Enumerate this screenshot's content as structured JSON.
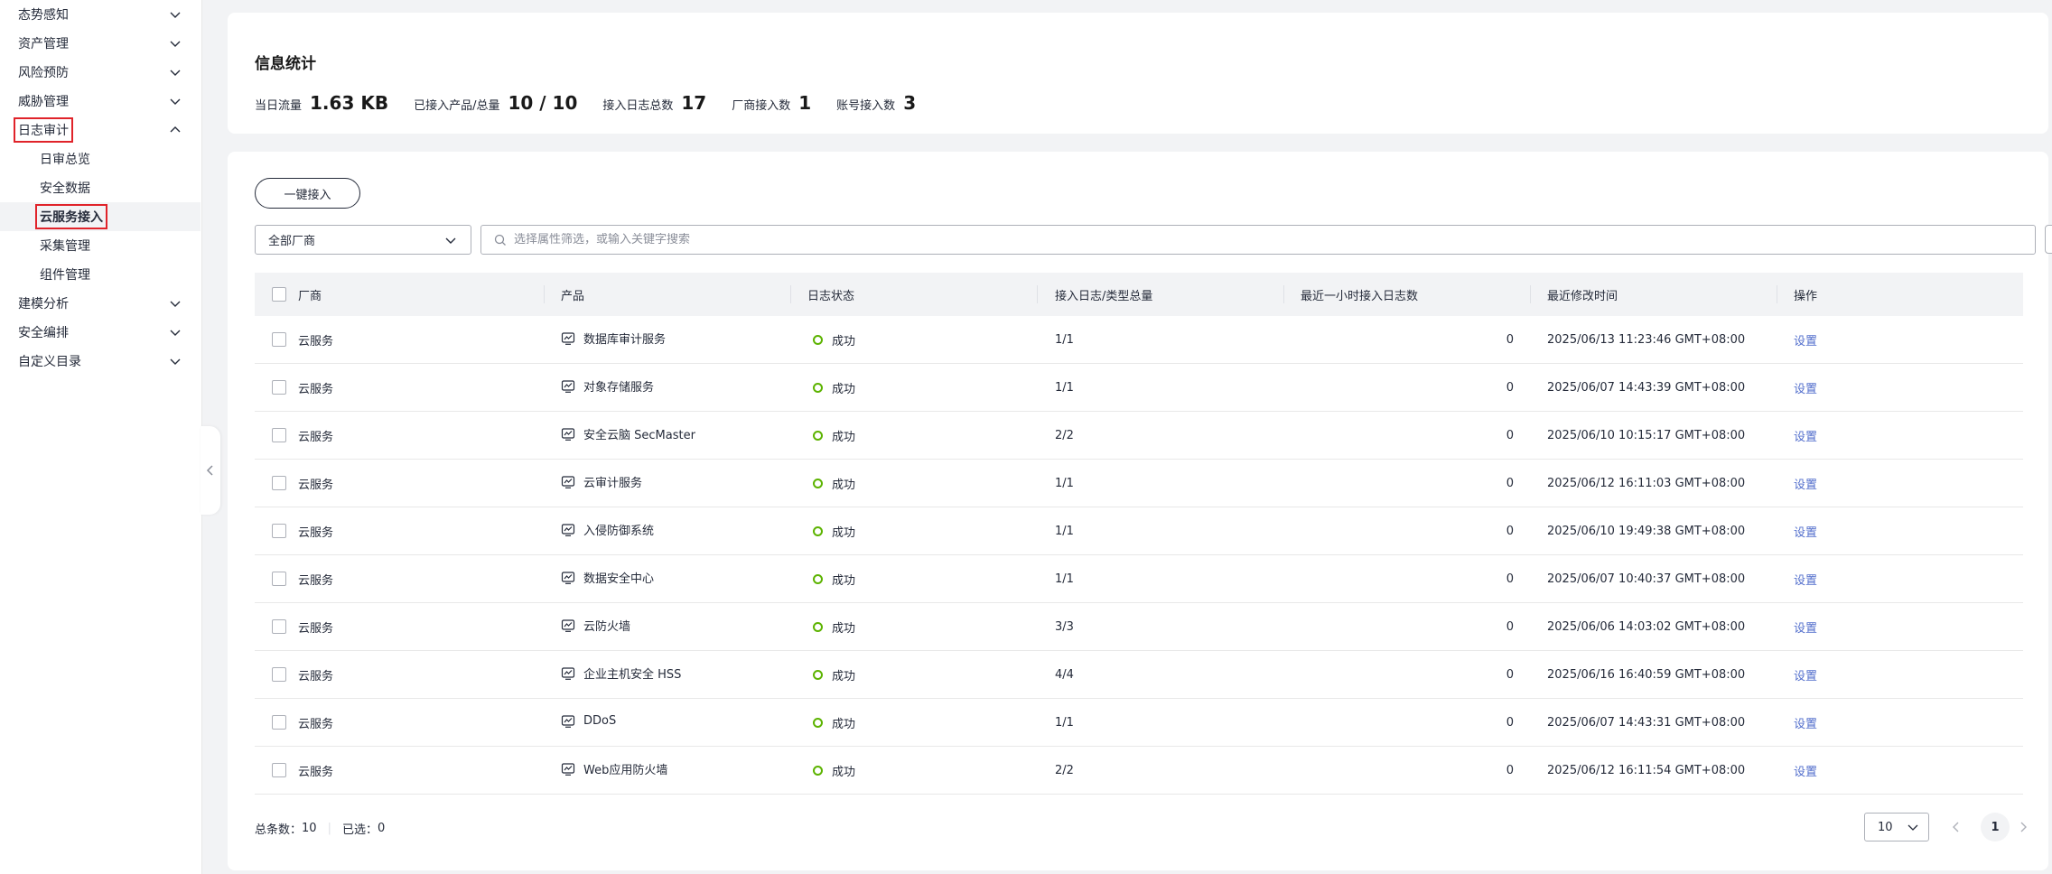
{
  "sidebar": {
    "groups_top": [
      {
        "label": "态势感知",
        "expanded": false
      },
      {
        "label": "资产管理",
        "expanded": false
      },
      {
        "label": "风险预防",
        "expanded": false
      },
      {
        "label": "威胁管理",
        "expanded": false
      },
      {
        "label": "日志审计",
        "expanded": true
      }
    ],
    "sub_items": [
      {
        "label": "日审总览"
      },
      {
        "label": "安全数据"
      },
      {
        "label": "云服务接入",
        "active": true
      },
      {
        "label": "采集管理"
      },
      {
        "label": "组件管理"
      }
    ],
    "groups_bottom": [
      {
        "label": "建模分析",
        "expanded": false
      },
      {
        "label": "安全编排",
        "expanded": false
      },
      {
        "label": "自定义目录",
        "expanded": false
      }
    ]
  },
  "stats": {
    "title": "信息统计",
    "items": [
      {
        "label": "当日流量",
        "value": "1.63 KB"
      },
      {
        "label": "已接入产品/总量",
        "value": "10 / 10"
      },
      {
        "label": "接入日志总数",
        "value": "17"
      },
      {
        "label": "厂商接入数",
        "value": "1"
      },
      {
        "label": "账号接入数",
        "value": "3"
      }
    ]
  },
  "toolbar": {
    "onekey_label": "一键接入",
    "vendor_select": "全部厂商",
    "search_placeholder": "选择属性筛选，或输入关键字搜索"
  },
  "table": {
    "headers": {
      "vendor": "厂商",
      "product": "产品",
      "status": "日志状态",
      "types": "接入日志/类型总量",
      "recent": "最近一小时接入日志数",
      "modified": "最近修改时间",
      "action": "操作"
    },
    "rows": [
      {
        "vendor": "云服务",
        "product": "数据库审计服务",
        "status": "成功",
        "types": "1/1",
        "recent": "0",
        "modified": "2025/06/13 11:23:46 GMT+08:00",
        "action": "设置"
      },
      {
        "vendor": "云服务",
        "product": "对象存储服务",
        "status": "成功",
        "types": "1/1",
        "recent": "0",
        "modified": "2025/06/07 14:43:39 GMT+08:00",
        "action": "设置"
      },
      {
        "vendor": "云服务",
        "product": "安全云脑 SecMaster",
        "status": "成功",
        "types": "2/2",
        "recent": "0",
        "modified": "2025/06/10 10:15:17 GMT+08:00",
        "action": "设置"
      },
      {
        "vendor": "云服务",
        "product": "云审计服务",
        "status": "成功",
        "types": "1/1",
        "recent": "0",
        "modified": "2025/06/12 16:11:03 GMT+08:00",
        "action": "设置"
      },
      {
        "vendor": "云服务",
        "product": "入侵防御系统",
        "status": "成功",
        "types": "1/1",
        "recent": "0",
        "modified": "2025/06/10 19:49:38 GMT+08:00",
        "action": "设置"
      },
      {
        "vendor": "云服务",
        "product": "数据安全中心",
        "status": "成功",
        "types": "1/1",
        "recent": "0",
        "modified": "2025/06/07 10:40:37 GMT+08:00",
        "action": "设置"
      },
      {
        "vendor": "云服务",
        "product": "云防火墙",
        "status": "成功",
        "types": "3/3",
        "recent": "0",
        "modified": "2025/06/06 14:03:02 GMT+08:00",
        "action": "设置"
      },
      {
        "vendor": "云服务",
        "product": "企业主机安全 HSS",
        "status": "成功",
        "types": "4/4",
        "recent": "0",
        "modified": "2025/06/16 16:40:59 GMT+08:00",
        "action": "设置"
      },
      {
        "vendor": "云服务",
        "product": "DDoS",
        "status": "成功",
        "types": "1/1",
        "recent": "0",
        "modified": "2025/06/07 14:43:31 GMT+08:00",
        "action": "设置"
      },
      {
        "vendor": "云服务",
        "product": "Web应用防火墙",
        "status": "成功",
        "types": "2/2",
        "recent": "0",
        "modified": "2025/06/12 16:11:54 GMT+08:00",
        "action": "设置"
      }
    ]
  },
  "footer": {
    "total_label": "总条数：",
    "total_value": "10",
    "selected_label": "已选：",
    "selected_value": "0",
    "page_size": "10",
    "current_page": "1"
  },
  "colors": {
    "success": "#5cb300",
    "link": "#526ecc",
    "highlight_box": "#e0232a"
  },
  "icons": {
    "expand": "chevron-down-icon",
    "collapse": "chevron-up-icon",
    "sidebar_toggle": "chevron-left-icon",
    "search": "search-icon",
    "refresh": "refresh-icon",
    "settings": "gear-icon",
    "product": "monitor-chart-icon"
  }
}
